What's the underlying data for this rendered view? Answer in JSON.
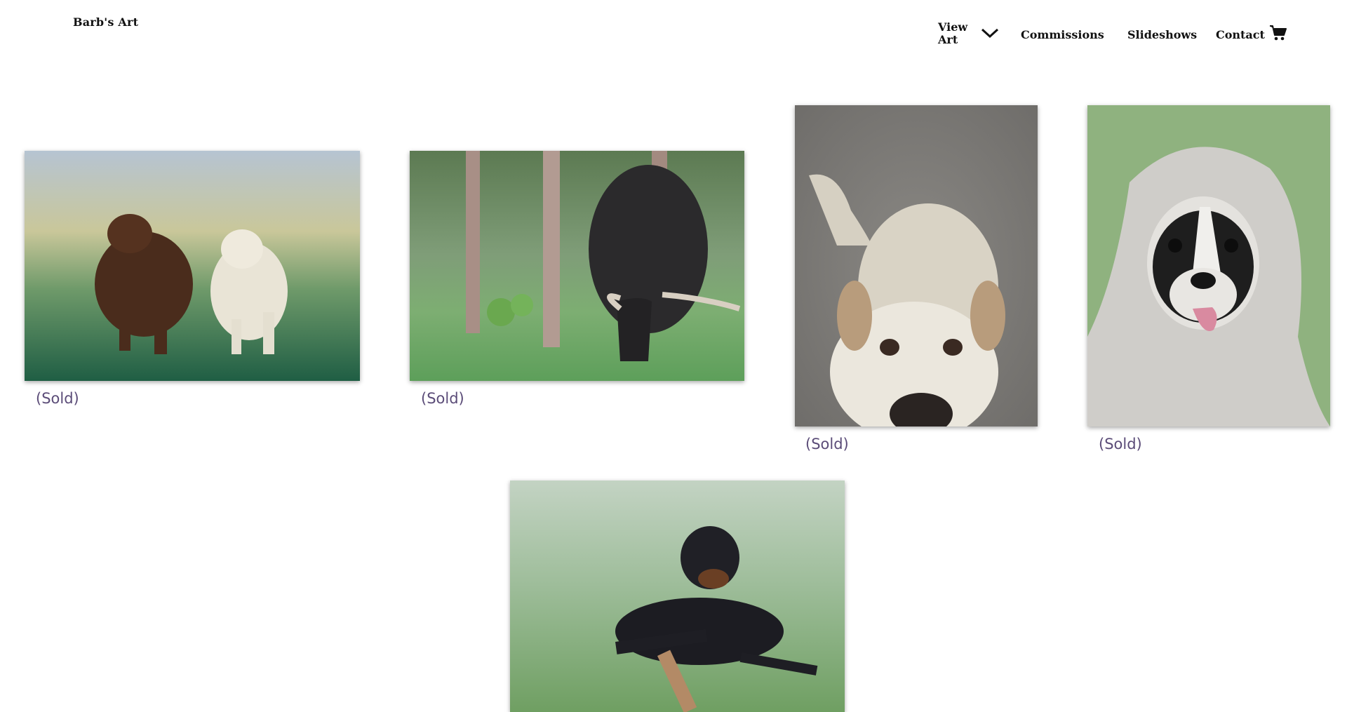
{
  "header": {
    "site_title": "Barb's Art",
    "nav": {
      "view_art": "View Art",
      "commissions": "Commissions",
      "slideshows": "Slideshows",
      "contact": "Contact"
    }
  },
  "gallery": {
    "items": [
      {
        "caption": "(Sold)",
        "subject": "chocolate and yellow labradors"
      },
      {
        "caption": "(Sold)",
        "subject": "highland cow grazing"
      },
      {
        "caption": "(Sold)",
        "subject": "wheaten terrier"
      },
      {
        "caption": "(Sold)",
        "subject": "boston terrier in blanket"
      },
      {
        "caption": "",
        "subject": "rottweiler lying on grass"
      }
    ]
  },
  "colors": {
    "caption": "#5b4c78",
    "text": "#111111"
  }
}
